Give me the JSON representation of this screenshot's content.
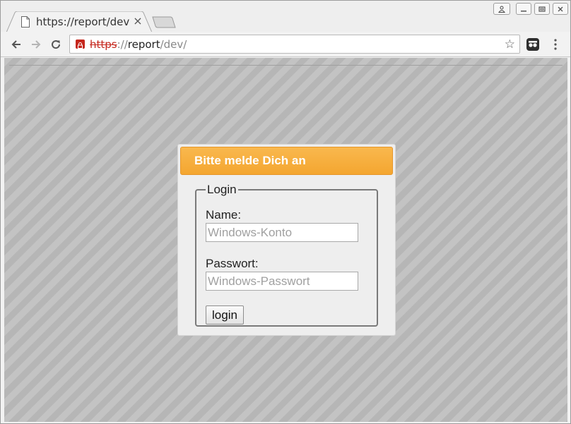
{
  "browser": {
    "tab": {
      "title": "https://report/dev/",
      "close_glyph": "×",
      "icon": "document-icon"
    },
    "address_bar": {
      "scheme": "https",
      "separator": "://",
      "host": "report",
      "path": "/dev/",
      "security_state": "insecure",
      "security_color": "#c5271d"
    },
    "toolbar": {
      "back_icon": "arrow-left-icon",
      "forward_icon": "arrow-right-icon",
      "reload_icon": "reload-icon",
      "star_glyph": "☆",
      "extension_icon": "extension-icon",
      "menu_icon": "kebab-menu-icon"
    }
  },
  "page": {
    "background_pattern": "diagonal-stripes",
    "login_box": {
      "header_title": "Bitte melde Dich an",
      "header_color": "#f6ab38",
      "fieldset_legend": "Login",
      "name_label": "Name:",
      "name_placeholder": "Windows-Konto",
      "name_value": "",
      "password_label": "Passwort:",
      "password_placeholder": "Windows-Passwort",
      "password_value": "",
      "submit_label": "login"
    }
  }
}
